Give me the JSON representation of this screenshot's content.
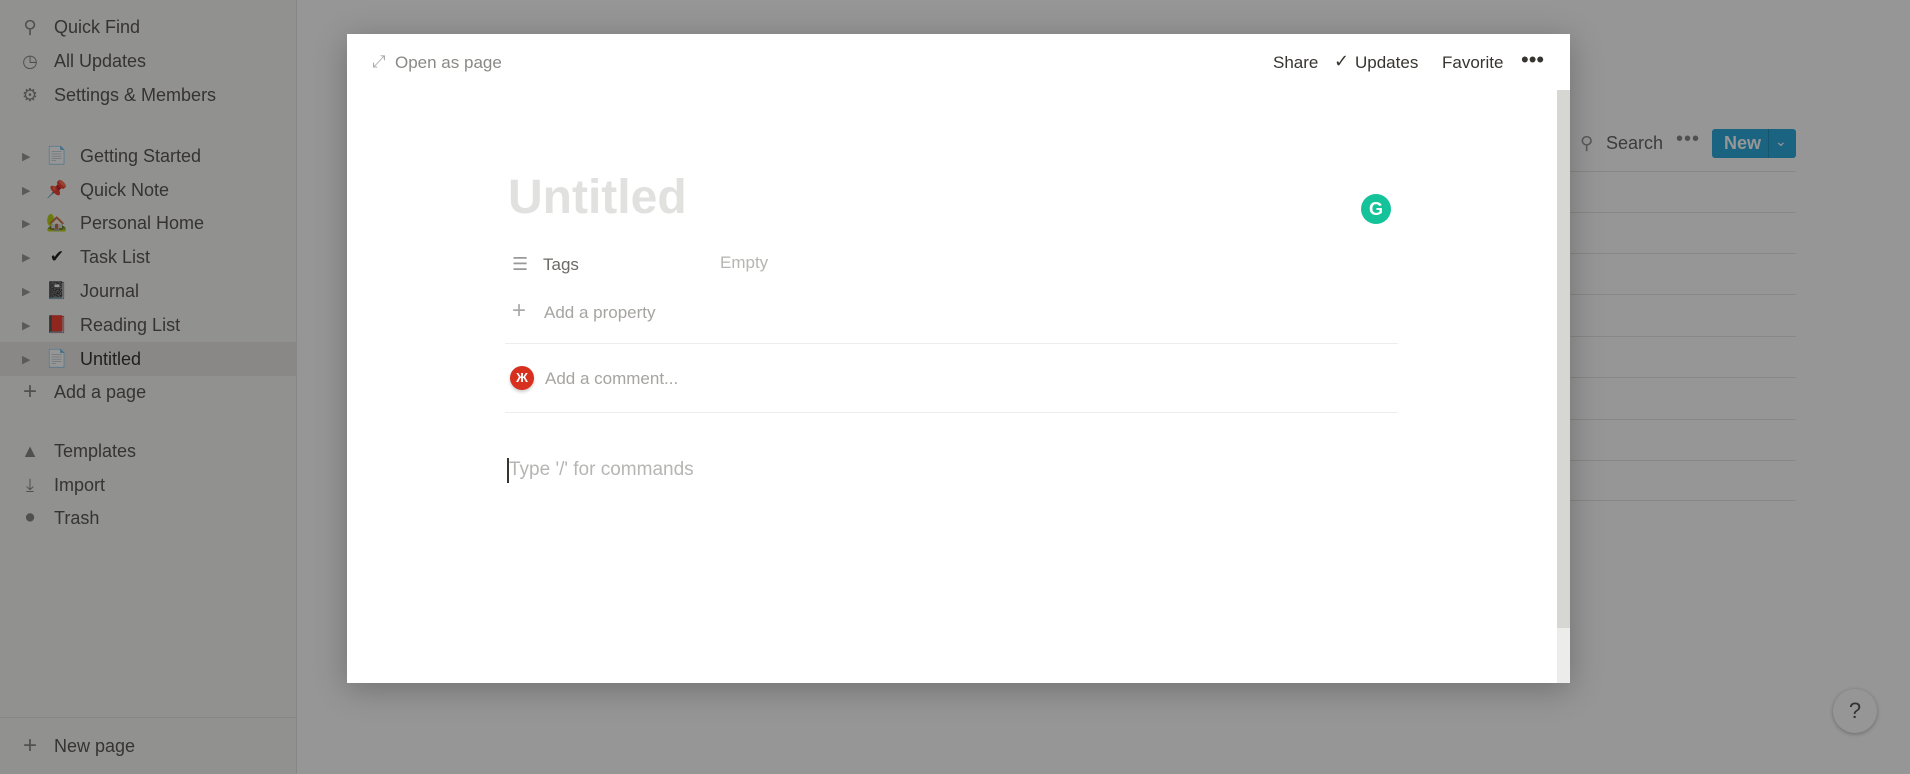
{
  "sidebar": {
    "top_items": [
      {
        "label": "Quick Find",
        "icon": "search-icon"
      },
      {
        "label": "All Updates",
        "icon": "clock-icon"
      },
      {
        "label": "Settings & Members",
        "icon": "gear-icon"
      }
    ],
    "pages": [
      {
        "label": "Getting Started",
        "icon": "page-icon",
        "emoji": "📄"
      },
      {
        "label": "Quick Note",
        "icon": "pushpin-icon",
        "emoji": "📌"
      },
      {
        "label": "Personal Home",
        "icon": "house-icon",
        "emoji": "🏡"
      },
      {
        "label": "Task List",
        "icon": "checkmark-icon",
        "emoji": "✔"
      },
      {
        "label": "Journal",
        "icon": "notebook-icon",
        "emoji": "📓"
      },
      {
        "label": "Reading List",
        "icon": "book-icon",
        "emoji": "📕"
      },
      {
        "label": "Untitled",
        "icon": "page-icon",
        "emoji": "📄",
        "selected": true
      }
    ],
    "add_page": "Add a page",
    "bottom_items": [
      {
        "label": "Templates",
        "icon": "templates-icon"
      },
      {
        "label": "Import",
        "icon": "import-icon"
      },
      {
        "label": "Trash",
        "icon": "trash-icon"
      }
    ],
    "new_page": "New page"
  },
  "background": {
    "search": "Search",
    "new_button": "New",
    "accent": "#2eaadc"
  },
  "modal": {
    "open_as_page": "Open as page",
    "share": "Share",
    "updates": "Updates",
    "favorite": "Favorite",
    "title_placeholder": "Untitled",
    "properties": [
      {
        "name": "Tags",
        "value": "Empty"
      }
    ],
    "add_property": "Add a property",
    "comment_placeholder": "Add a comment...",
    "body_placeholder": "Type '/' for commands",
    "avatar_text": "Ж"
  },
  "help": "?"
}
